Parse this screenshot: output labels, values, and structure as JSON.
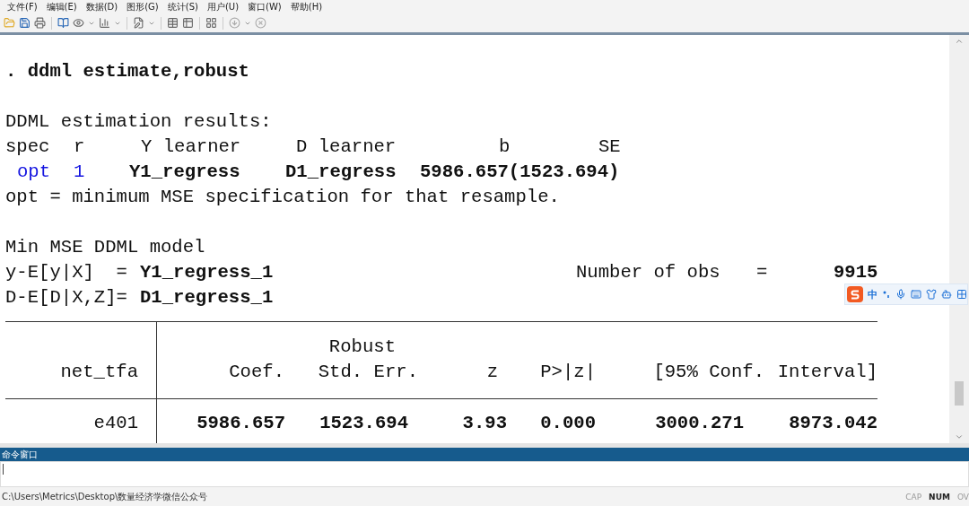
{
  "menu": [
    "文件(F)",
    "编辑(E)",
    "数据(D)",
    "图形(G)",
    "统计(S)",
    "用户(U)",
    "窗口(W)",
    "帮助(H)"
  ],
  "results": {
    "command": ". ddml estimate,robust",
    "heading": "DDML estimation results:",
    "spec_header": [
      "spec",
      "r",
      "Y learner",
      "D learner",
      "b",
      "SE"
    ],
    "spec_row": {
      "spec": "opt",
      "r": "1",
      "y_learner": "Y1_regress",
      "d_learner": "D1_regress",
      "b_se": "5986.657(1523.694)"
    },
    "note": "opt = minimum MSE specification for that resample.",
    "model_title": "Min MSE DDML model",
    "equations": [
      {
        "lhs": "y-E[y|X]  =",
        "rhs": "Y1_regress_1"
      },
      {
        "lhs": "D-E[D|X,Z]=",
        "rhs": "D1_regress_1"
      }
    ],
    "obs": {
      "label": "Number of obs",
      "eq": "=",
      "value": "9915"
    },
    "table": {
      "header_top": "Robust",
      "columns": [
        {
          "label": "net_tfa"
        },
        {
          "label": "Coef."
        },
        {
          "label": "Std. Err."
        },
        {
          "label": "z"
        },
        {
          "label": "P>|z|"
        },
        {
          "label": "[95% Conf."
        },
        {
          "label": "Interval]"
        }
      ],
      "rows": [
        {
          "cells": [
            "e401",
            "5986.657",
            "1523.694",
            "3.93",
            "0.000",
            "3000.271",
            "8973.042"
          ]
        }
      ]
    }
  },
  "ime_bar": {
    "label": "中"
  },
  "command_window": {
    "title": "命令窗口"
  },
  "status_bar": {
    "path": "C:\\Users\\Metrics\\Desktop\\数量经济学微信公众号",
    "indicators": [
      {
        "label": "CAP",
        "on": false
      },
      {
        "label": "NUM",
        "on": true
      },
      {
        "label": "OV",
        "on": false
      }
    ]
  }
}
